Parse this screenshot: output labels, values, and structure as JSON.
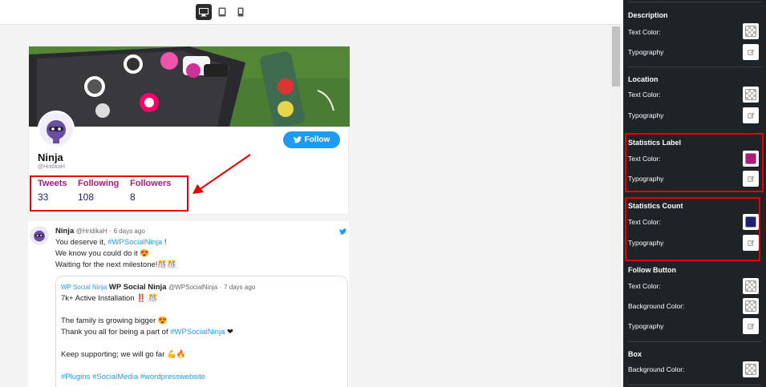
{
  "devices": [
    {
      "name": "desktop",
      "active": true
    },
    {
      "name": "tablet",
      "active": false
    },
    {
      "name": "mobile",
      "active": false
    }
  ],
  "profile": {
    "name": "Ninja",
    "handle": "@HridikaH",
    "follow_label": "Follow",
    "stats": [
      {
        "label": "Tweets",
        "count": "33"
      },
      {
        "label": "Following",
        "count": "108"
      },
      {
        "label": "Followers",
        "count": "8"
      }
    ]
  },
  "tweet": {
    "author": "Ninja",
    "handle": "@HridikaH",
    "time": "6 days ago",
    "line1_text": "You deserve it,",
    "line1_tag": "#WPSocialNinja",
    "line1_end": "!",
    "line2": "We know you could do it 😍",
    "line3": "Waiting for the next milestone!🎊🎊",
    "quote": {
      "img_alt": "WP Social Ninja",
      "author": "WP Social Ninja",
      "handle": "@WPSocialNinja",
      "time": "7 days ago",
      "line1": "7k+ Active Installation ‼️ 🎊",
      "line2": "The family is growing bigger 😍",
      "line3_text": "Thank you all for being a part of",
      "line3_tag": "#WPSocialNinja",
      "line3_end": "❤",
      "line4": "Keep supporting; we will go far 💪🔥",
      "tags": "#Plugins #SocialMedia #wordpresswebsite"
    }
  },
  "sidebar": {
    "description": {
      "title": "Description",
      "text_color": "Text Color:",
      "typography": "Typography"
    },
    "location": {
      "title": "Location",
      "text_color": "Text Color:",
      "typography": "Typography"
    },
    "stat_label": {
      "title": "Statistics Label",
      "text_color": "Text Color:",
      "typography": "Typography",
      "color": "#b5177d"
    },
    "stat_count": {
      "title": "Statistics Count",
      "text_color": "Text Color:",
      "typography": "Typography",
      "color": "#1f2070"
    },
    "follow_button": {
      "title": "Follow Button",
      "text_color": "Text Color:",
      "bg_color": "Background Color:",
      "typography": "Typography"
    },
    "box": {
      "title": "Box",
      "bg_color": "Background Color:"
    }
  },
  "colors": {
    "accent": "#1d9bf0",
    "highlight": "#e60000",
    "stat_label": "#b5177d",
    "stat_count": "#1f2070"
  }
}
